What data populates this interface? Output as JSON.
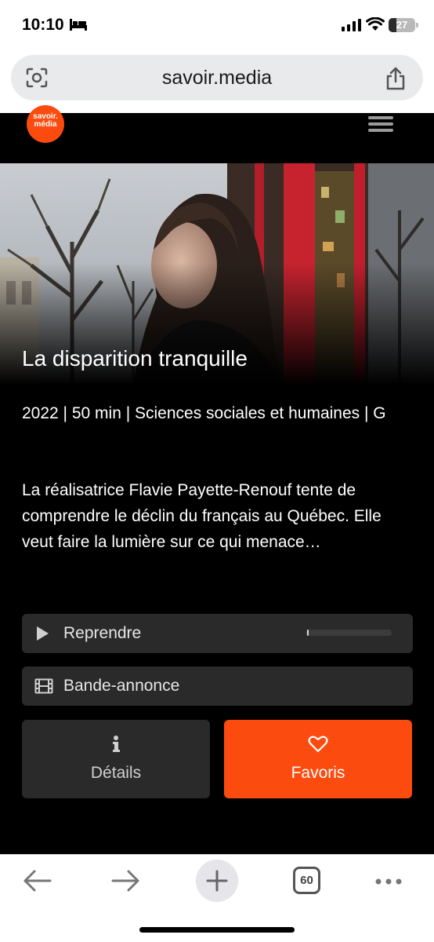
{
  "status": {
    "time": "10:10",
    "battery": "27"
  },
  "browser": {
    "url": "savoir.media",
    "tab_count": "60"
  },
  "site": {
    "logo_line1": "savoir.",
    "logo_line2": "média"
  },
  "video": {
    "title": "La disparition tranquille",
    "meta": "2022 | 50 min | Sciences sociales et humaines | G",
    "description": "La réalisatrice Flavie Payette-Renouf tente de comprendre le déclin du français au Québec. Elle veut faire la lumière sur ce qui menace…",
    "resume_progress_fraction": 0.02
  },
  "actions": {
    "resume_label": "Reprendre",
    "trailer_label": "Bande-annonce",
    "details_label": "Détails",
    "favorites_label": "Favoris"
  },
  "colors": {
    "accent": "#fc4b0f",
    "button_dark": "#2a2a2a"
  },
  "icons": {
    "play": "play-icon",
    "film": "film-icon",
    "info": "info-icon",
    "heart": "heart-icon",
    "menu": "hamburger-menu-icon"
  }
}
